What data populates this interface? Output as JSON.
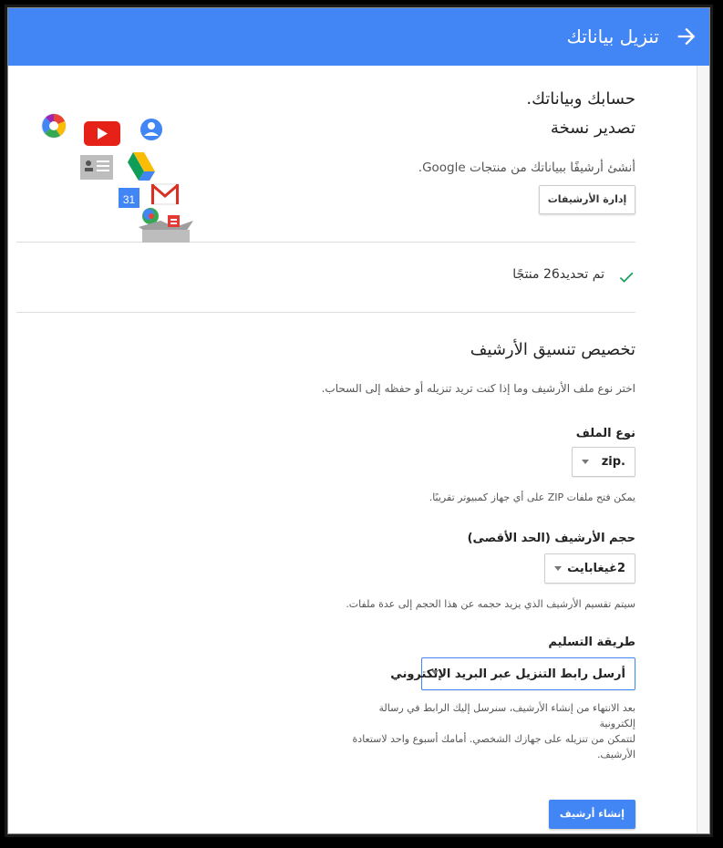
{
  "header": {
    "title": "تنزيل بياناتك",
    "back_icon": "arrow-right-icon"
  },
  "account": {
    "heading": "حسابك وبياناتك.",
    "subheading": "تصدير نسخة",
    "description": "أنشئ أرشيفًا ببياناتك من منتجات Google.",
    "manage_button": "إدارة الأرشيفات",
    "illustration_icons": [
      "picasa-icon",
      "youtube-icon",
      "profile-icon",
      "contacts-icon",
      "drive-icon",
      "calendar-icon",
      "gmail-icon",
      "hangouts-icon",
      "blogger-icon",
      "box-icon"
    ],
    "calendar_day": "31"
  },
  "selection": {
    "status_text": "تم تحديد26 منتجًا",
    "icon": "checkmark-icon"
  },
  "format": {
    "title": "تخصيص تنسيق الأرشيف",
    "description": "اختر نوع ملف الأرشيف وما إذا كنت تريد تنزيله أو حفظه إلى السحاب.",
    "file_type": {
      "label": "نوع الملف",
      "value": ".zip",
      "note": "يمكن فتح ملفات ZIP على أي جهاز كمبيوتر تقريبًا."
    },
    "archive_size": {
      "label": "حجم الأرشيف (الحد الأقصى)",
      "value": "2غيغابايت",
      "note": "سيتم تقسيم الأرشيف الذي يزيد حجمه عن هذا الحجم إلى عدة ملفات."
    },
    "delivery": {
      "label": "طريقة التسليم",
      "value": "أرسل رابط التنزيل عبر البريد الإلكتروني",
      "note_lines": [
        "بعد الانتهاء من إنشاء الأرشيف، سنرسل إليك الرابط في رسالة إلكترونية",
        "لتتمكن من تنزيله على جهازك الشخصي. أمامك أسبوع واحد لاستعادة",
        "الأرشيف."
      ]
    },
    "create_button": "إنشاء أرشيف"
  },
  "colors": {
    "header_blue": "#4285f4",
    "check_green": "#0f9d58"
  }
}
